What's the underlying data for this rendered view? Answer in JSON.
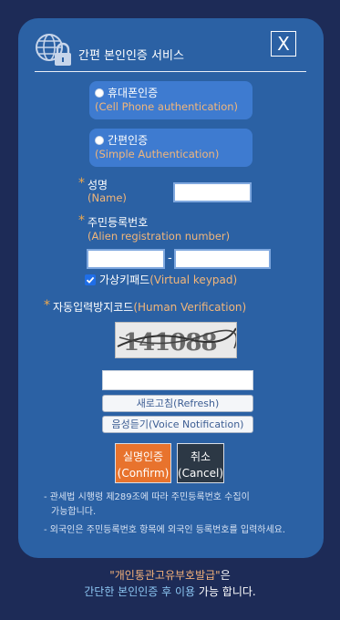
{
  "dialog": {
    "title": "간편 본인인증 서비스",
    "close_label": "X"
  },
  "options": [
    {
      "label_ko": "휴대폰인증",
      "label_en": "(Cell Phone authentication)"
    },
    {
      "label_ko": "간편인증",
      "label_en": "(Simple Authentication)"
    }
  ],
  "name_field": {
    "star": "*",
    "label_ko": "성명",
    "label_en": "(Name)",
    "value": ""
  },
  "reg_field": {
    "star": "*",
    "label_ko": "주민등록번호",
    "label_en": "(Alien registration number)",
    "part1": "",
    "separator": "-",
    "part2": ""
  },
  "virtual_keypad": {
    "label_ko": "가상키패드",
    "label_en": "(Virtual keypad)",
    "checked": true
  },
  "captcha": {
    "star": "*",
    "label_ko": "자동입력방지코드",
    "label_en": "(Human Verification)",
    "image_text": "141088",
    "input_value": "",
    "refresh_label": "새로고침(Refresh)",
    "voice_label": "음성듣기(Voice Notification)"
  },
  "actions": {
    "confirm_ko": "실명인증",
    "confirm_en": "(Confirm)",
    "cancel_ko": "취소",
    "cancel_en": "(Cancel)"
  },
  "notes": {
    "note1_line1": "- 관세법 시행령 제289조에 따라 주민등록번호 수집이",
    "note1_line2": "가능합니다.",
    "note2": "- 외국인은 주민등록번호 항목에 외국인 등록번호를 입력하세요."
  },
  "footer": {
    "quote": "\"개인통관고유부호발급\"",
    "suffix1": "은",
    "highlight": "간단한 본인인증 후 이용",
    "suffix2": " 가능 합니다."
  },
  "colors": {
    "background": "#1d2b57",
    "card": "#2b61a4",
    "option": "#3e7bd0",
    "accent_orange": "#e8732d",
    "label_orange": "#f2b67a",
    "cancel": "#2c3845"
  }
}
